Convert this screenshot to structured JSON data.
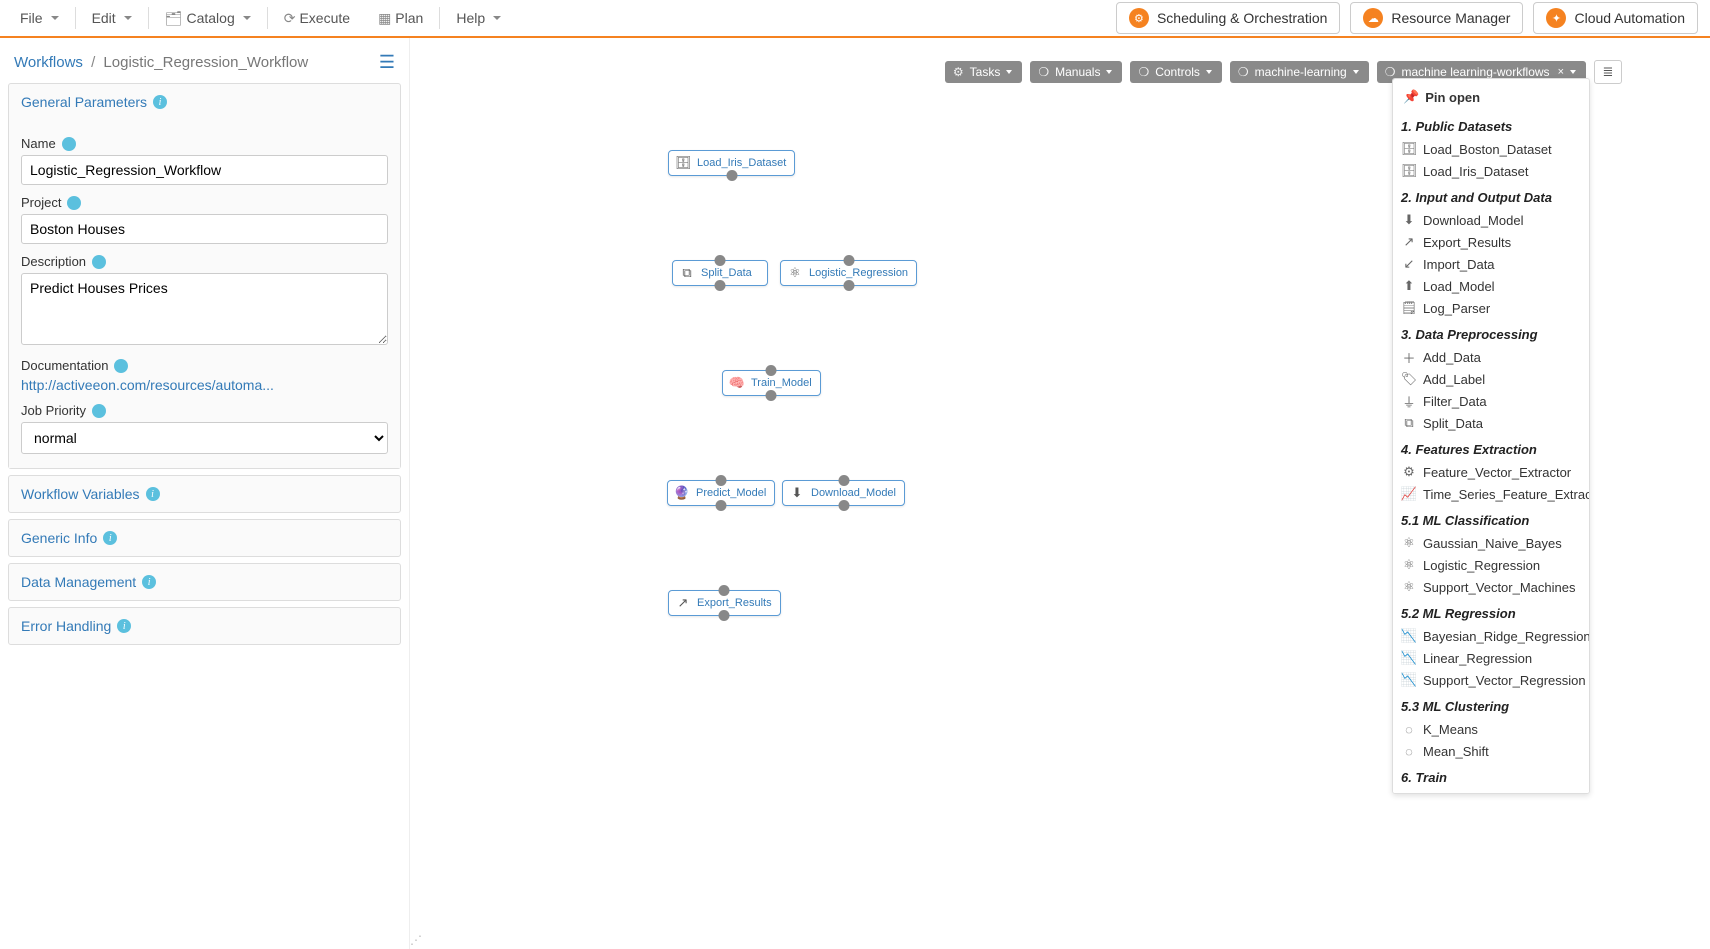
{
  "menu": {
    "file": "File",
    "edit": "Edit",
    "catalog": "Catalog",
    "execute": "Execute",
    "plan": "Plan",
    "help": "Help"
  },
  "apps": {
    "sched": "Scheduling & Orchestration",
    "rm": "Resource Manager",
    "cloud": "Cloud Automation"
  },
  "crumbs": {
    "root": "Workflows",
    "current": "Logistic_Regression_Workflow"
  },
  "params": {
    "header": "General Parameters",
    "name_label": "Name",
    "name_value": "Logistic_Regression_Workflow",
    "project_label": "Project",
    "project_value": "Boston Houses",
    "desc_label": "Description",
    "desc_value": "Predict Houses Prices",
    "doc_label": "Documentation",
    "doc_link": "http://activeeon.com/resources/automa...",
    "priority_label": "Job Priority",
    "priority_value": "normal",
    "accordion": {
      "vars": "Workflow Variables",
      "ginfo": "Generic Info",
      "data": "Data Management",
      "err": "Error Handling"
    }
  },
  "palette_bar": {
    "tasks": "Tasks",
    "manuals": "Manuals",
    "controls": "Controls",
    "ml": "machine-learning",
    "mlwf": "machine learning-workflows"
  },
  "nodes": {
    "load": "Load_Iris_Dataset",
    "split": "Split_Data",
    "logreg": "Logistic_Regression",
    "train": "Train_Model",
    "predict": "Predict_Model",
    "download": "Download_Model",
    "export": "Export_Results"
  },
  "palette": {
    "pin": "Pin open",
    "h1": "1. Public Datasets",
    "g1": [
      "Load_Boston_Dataset",
      "Load_Iris_Dataset"
    ],
    "h2": "2. Input and Output Data",
    "g2": [
      "Download_Model",
      "Export_Results",
      "Import_Data",
      "Load_Model",
      "Log_Parser"
    ],
    "h3": "3. Data Preprocessing",
    "g3": [
      "Add_Data",
      "Add_Label",
      "Filter_Data",
      "Split_Data"
    ],
    "h4": "4. Features Extraction",
    "g4": [
      "Feature_Vector_Extractor",
      "Time_Series_Feature_Extractor"
    ],
    "h5": "5.1 ML Classification",
    "g5": [
      "Gaussian_Naive_Bayes",
      "Logistic_Regression",
      "Support_Vector_Machines"
    ],
    "h6": "5.2 ML Regression",
    "g6": [
      "Bayesian_Ridge_Regression",
      "Linear_Regression",
      "Support_Vector_Regression"
    ],
    "h7": "5.3 ML Clustering",
    "g7": [
      "K_Means",
      "Mean_Shift"
    ],
    "h8": "6. Train"
  }
}
